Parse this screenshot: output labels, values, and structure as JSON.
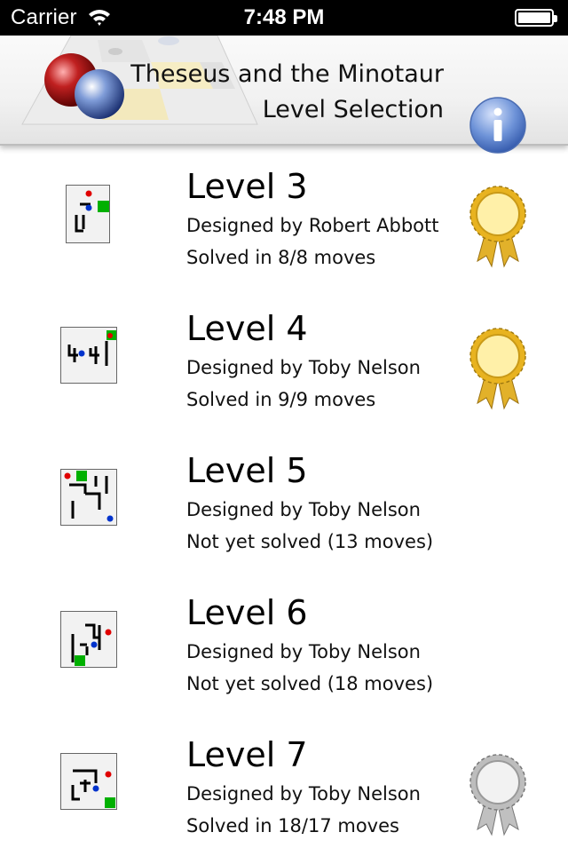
{
  "status_bar": {
    "carrier": "Carrier",
    "time": "7:48 PM",
    "wifi_icon": "wifi-icon",
    "battery_icon": "battery-icon"
  },
  "header": {
    "title_line1": "Theseus and the Minotaur",
    "title_line2": "Level Selection",
    "logo_icon": "game-board-logo",
    "info_icon": "info-icon"
  },
  "colors": {
    "minotaur_marker": "#e00000",
    "theseus_marker": "#0033cc",
    "exit_marker": "#00b000",
    "gold_medal": "#f0c020",
    "silver_medal": "#c8c8c8"
  },
  "levels": [
    {
      "name": "Level 3",
      "designer": "Designed by Robert Abbott",
      "status": "Solved in 8/8 moves",
      "medal": "gold"
    },
    {
      "name": "Level 4",
      "designer": "Designed by Toby Nelson",
      "status": "Solved in 9/9 moves",
      "medal": "gold"
    },
    {
      "name": "Level 5",
      "designer": "Designed by Toby Nelson",
      "status": "Not yet solved (13 moves)",
      "medal": "none"
    },
    {
      "name": "Level 6",
      "designer": "Designed by Toby Nelson",
      "status": "Not yet solved (18 moves)",
      "medal": "none"
    },
    {
      "name": "Level 7",
      "designer": "Designed by Toby Nelson",
      "status": "Solved in 18/17 moves",
      "medal": "silver"
    }
  ]
}
